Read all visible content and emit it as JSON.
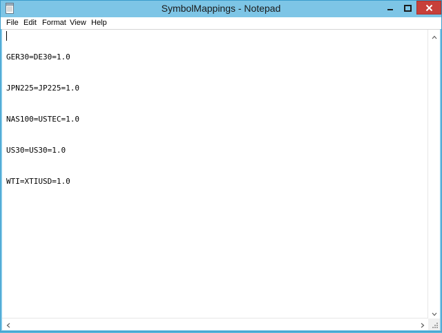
{
  "window": {
    "title": "SymbolMappings - Notepad",
    "colors": {
      "frame": "#7dc5e6",
      "close": "#c7403a"
    }
  },
  "titlebar_buttons": {
    "minimize_icon": "minimize-icon",
    "maximize_icon": "maximize-icon",
    "close_icon": "close-icon"
  },
  "menu": {
    "items": [
      {
        "label": "File"
      },
      {
        "label": "Edit"
      },
      {
        "label": "Format"
      },
      {
        "label": "View"
      },
      {
        "label": "Help"
      }
    ]
  },
  "document": {
    "lines": [
      "GER30=DE30=1.0",
      "JPN225=JP225=1.0",
      "NAS100=USTEC=1.0",
      "US30=US30=1.0",
      "WTI=XTIUSD=1.0"
    ]
  }
}
